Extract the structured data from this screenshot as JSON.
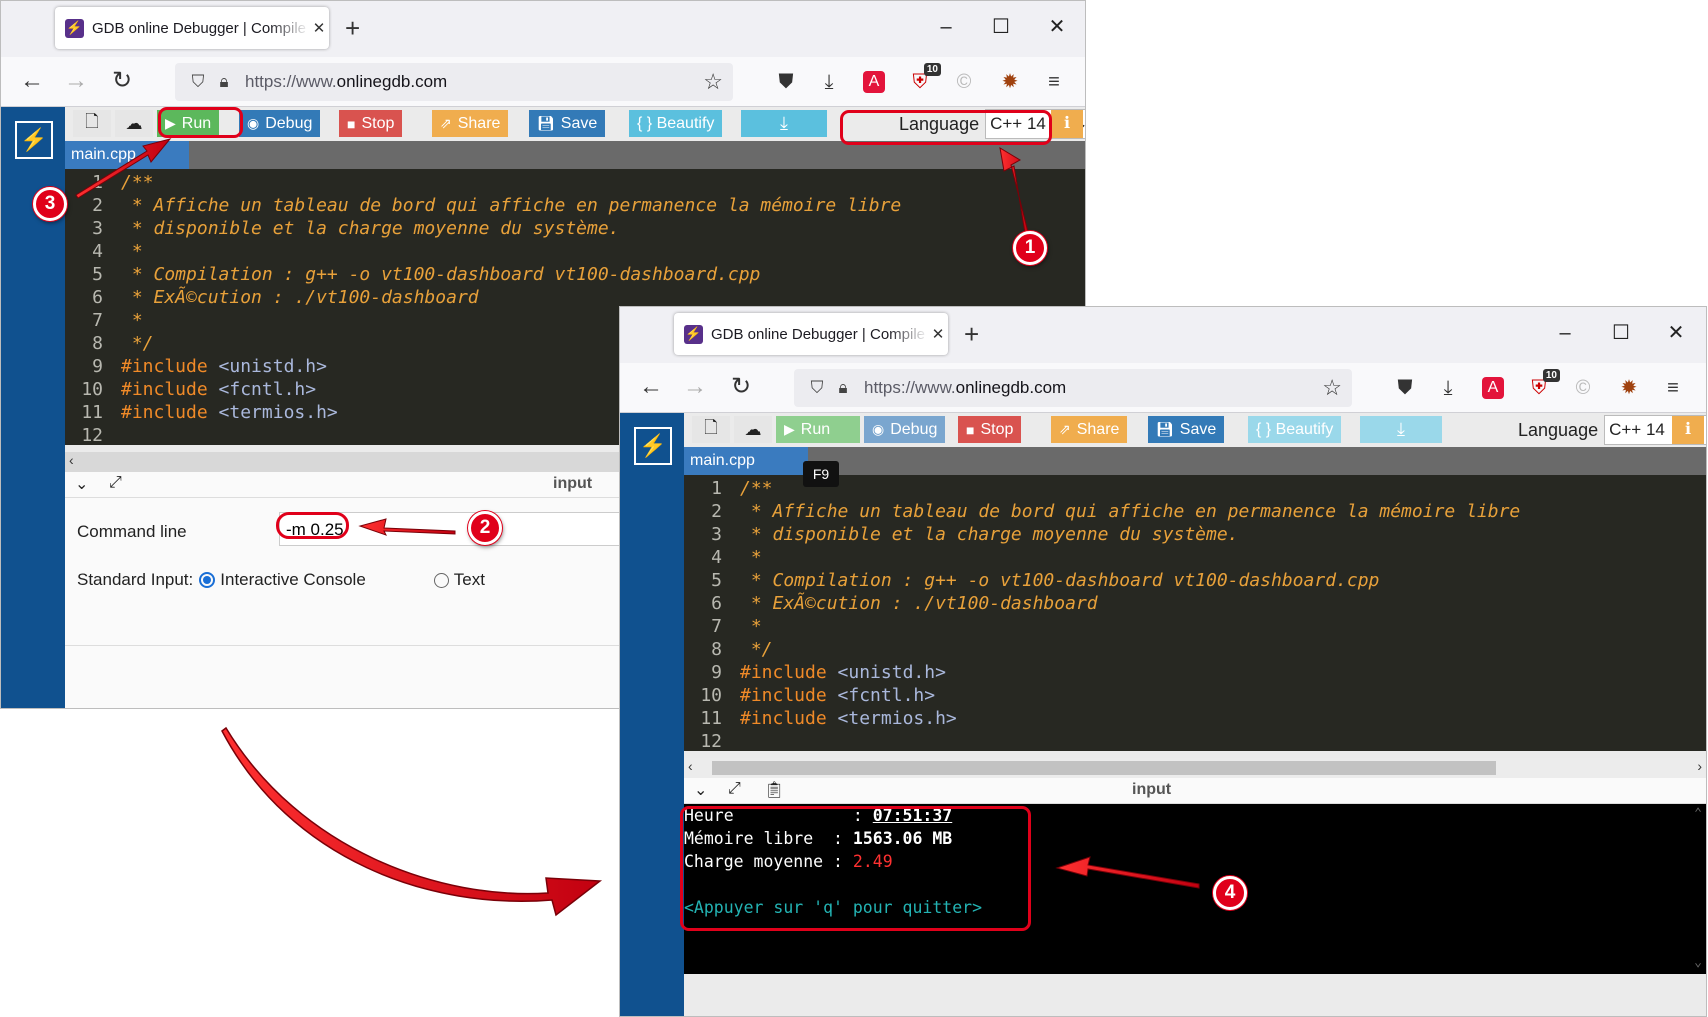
{
  "browser": {
    "tab_title": "GDB online Debugger | Compile",
    "url_prefix": "https://www.",
    "url_domain": "onlinegdb.com",
    "ext_badge": "10"
  },
  "toolbar": {
    "run": "Run",
    "debug": "Debug",
    "stop": "Stop",
    "share": "Share",
    "save": "Save",
    "beautify": "{ } Beautify",
    "language_label": "Language",
    "language_value": "C++ 14"
  },
  "file_tab": "main.cpp",
  "tooltip": "F9",
  "code_lines": [
    {
      "n": "1",
      "t": "/**"
    },
    {
      "n": "2",
      "t": " * Affiche un tableau de bord qui affiche en permanence la mémoire libre"
    },
    {
      "n": "3",
      "t": " * disponible et la charge moyenne du système."
    },
    {
      "n": "4",
      "t": " *"
    },
    {
      "n": "5",
      "t": " * Compilation : g++ -o vt100-dashboard vt100-dashboard.cpp"
    },
    {
      "n": "6",
      "t": " * ExÃ©cution : ./vt100-dashboard"
    },
    {
      "n": "7",
      "t": " *"
    },
    {
      "n": "8",
      "t": " */"
    },
    {
      "n": "9",
      "t": "#include",
      "h": "<unistd.h>"
    },
    {
      "n": "10",
      "t": "#include",
      "h": "<fcntl.h>"
    },
    {
      "n": "11",
      "t": "#include",
      "h": "<termios.h>"
    },
    {
      "n": "12",
      "t": ""
    }
  ],
  "panel": {
    "title": "input",
    "command_line_label": "Command line",
    "command_line_value": "-m 0.25",
    "stdin_label": "Standard Input:",
    "interactive_console": "Interactive Console",
    "text_option": "Text"
  },
  "terminal": {
    "heure_label": "Heure            : ",
    "heure_value": "07:51:37",
    "memoire_label": "Mémoire libre  : ",
    "memoire_value": "1563.06 MB",
    "charge_label": "Charge moyenne : ",
    "charge_value": "2.49",
    "quit_hint": "<Appuyer sur 'q' pour quitter>"
  },
  "annotations": [
    "1",
    "2",
    "3",
    "4"
  ],
  "colors": {
    "annotation": "#e0001a",
    "sidebar": "#10518f",
    "run": "#5cb85c"
  }
}
